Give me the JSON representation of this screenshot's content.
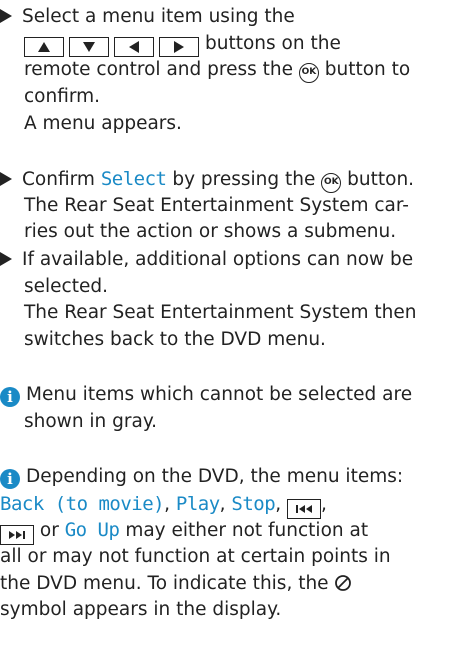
{
  "steps": {
    "step1": {
      "line1": "Select a menu item using the",
      "line2_after_keys": "buttons on the",
      "line3": "remote control and press the",
      "line3_after_ok": "button to",
      "line4": "confirm.",
      "result": "A menu appears."
    },
    "step2": {
      "line1_before": "Confirm",
      "line1_menu": "Select",
      "line1_mid": "by pressing the",
      "line1_after": "button.",
      "line2": "The Rear Seat Entertainment System car-",
      "line3": "ries out the action or shows a submenu."
    },
    "step3": {
      "line1": "If available, additional options can now be",
      "line2": "selected.",
      "line3": "The Rear Seat Entertainment System then",
      "line4": "switches back to the DVD menu."
    }
  },
  "notes": {
    "note1": {
      "line1": "Menu items which cannot be selected are",
      "line2": "shown in gray."
    },
    "note2": {
      "line1": "Depending on the DVD, the menu items:",
      "back_to_movie": "Back (to movie)",
      "play": "Play",
      "stop": "Stop",
      "comma": ",",
      "line3_after": "or",
      "go_up": "Go Up",
      "line3_end": "may either not function at",
      "line4": "all or may not function at certain points in",
      "line5_before": "the DVD menu. To indicate this, the",
      "line6": "symbol appears in the display."
    }
  },
  "ok_label": "OK",
  "icons": {
    "bullet": "triangle-right-icon",
    "up": "arrow-up-icon",
    "down": "arrow-down-icon",
    "left": "arrow-left-icon",
    "right": "arrow-right-icon",
    "ok": "ok-button-icon",
    "info": "info-icon",
    "skip_back": "skip-back-icon",
    "skip_forward": "skip-forward-icon",
    "prohibited": "prohibited-icon"
  },
  "colors": {
    "text": "#222222",
    "menu": "#1a8ac6",
    "info": "#1a8ac6"
  }
}
